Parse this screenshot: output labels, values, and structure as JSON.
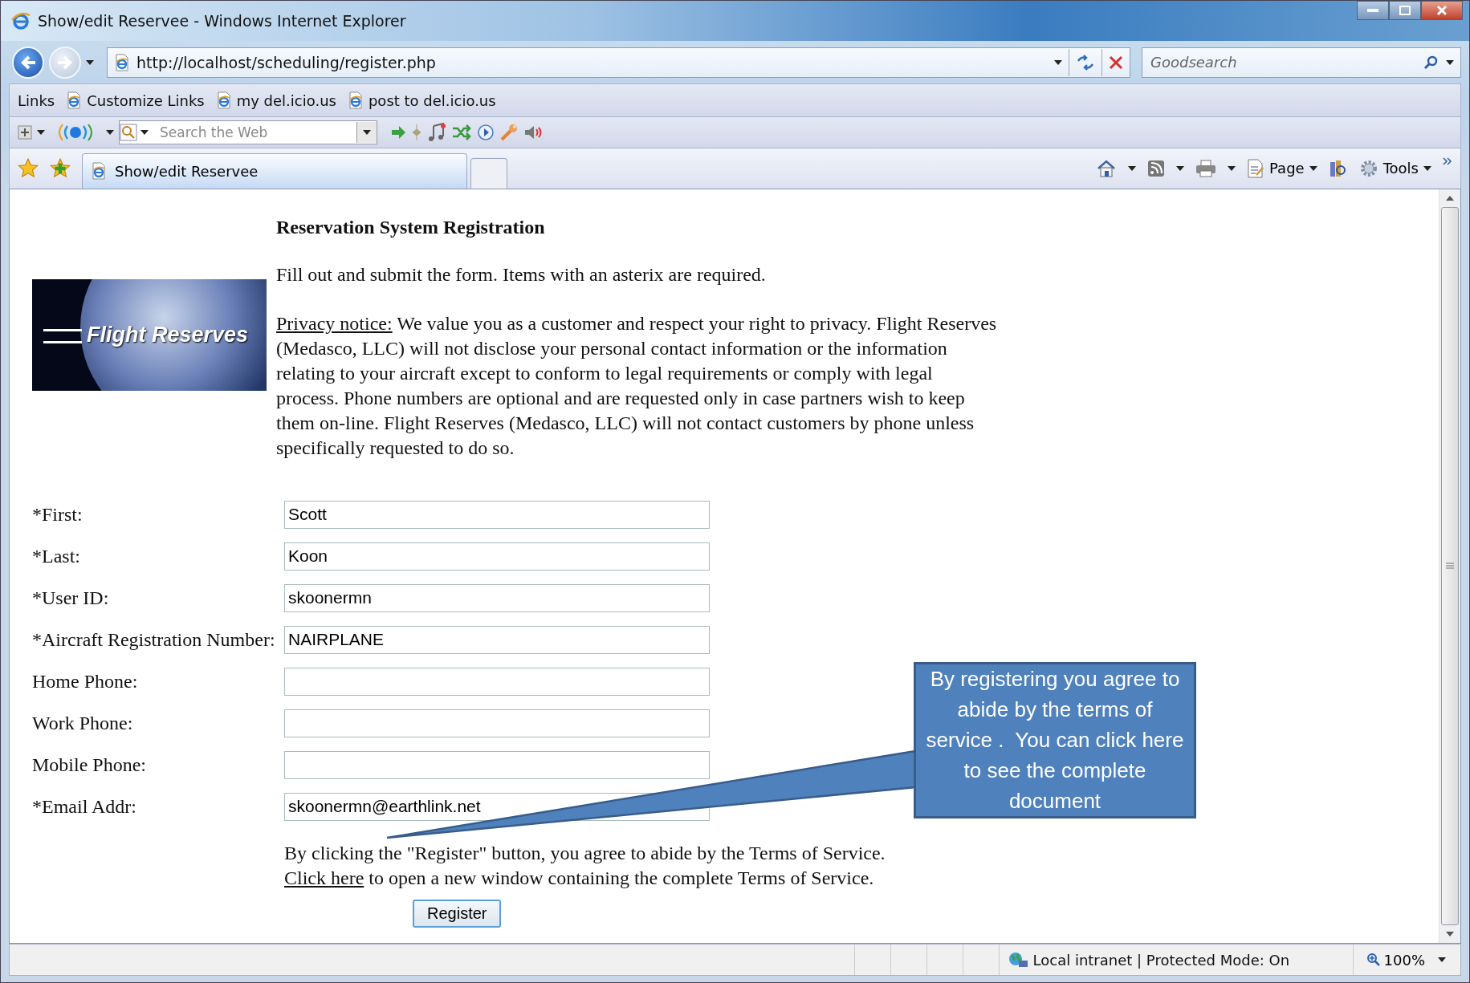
{
  "window": {
    "title": "Show/edit Reservee - Windows Internet Explorer"
  },
  "address_bar": {
    "url": "http://localhost/scheduling/register.php"
  },
  "search_box": {
    "placeholder": "Goodsearch"
  },
  "links_bar": {
    "label": "Links",
    "items": [
      "Customize Links",
      "my del.icio.us",
      "post to del.icio.us"
    ]
  },
  "toolbar": {
    "search_placeholder": "Search the Web"
  },
  "tabs": [
    {
      "label": "Show/edit Reservee",
      "selected": true
    }
  ],
  "command_bar": [
    "Page",
    "Tools"
  ],
  "page": {
    "heading": "Reservation System Registration",
    "intro": "Fill out and submit the form. Items with an asterix are required.",
    "logo_text": "Flight Reserves",
    "privacy_link": "Privacy notice:",
    "privacy_text": "We value you as a customer and respect your right to privacy. Flight Reserves (Medasco, LLC) will not disclose your personal contact information or the information relating to your aircraft except to conform to legal requirements or comply with legal process. Phone numbers are optional and are requested only in case partners wish to keep them on-line. Flight Reserves (Medasco, LLC) will not contact customers by phone unless specifically requested to do so.",
    "fields": [
      {
        "label": "*First:",
        "value": "Scott"
      },
      {
        "label": "*Last:",
        "value": "Koon"
      },
      {
        "label": "*User ID:",
        "value": "skoonermn"
      },
      {
        "label": "*Aircraft Registration Number:",
        "value": "NAIRPLANE"
      },
      {
        "label": "Home Phone:"
      },
      {
        "label": "Work Phone:"
      },
      {
        "label": "Mobile Phone:"
      },
      {
        "label": "*Email Addr:",
        "value": "skoonermn@earthlink.net"
      }
    ],
    "terms_text": "By clicking the \"Register\" button, you agree to abide by the Terms of Service.",
    "terms_link": "Click here",
    "terms_rest": "to open a new window containing the complete Terms of Service.",
    "button": "Register"
  },
  "callout": "By registering you agree to abide by the terms of service .  You can click here to see the complete document",
  "status_bar": {
    "zone": "Local intranet | Protected Mode: On",
    "zoom": "100%"
  }
}
